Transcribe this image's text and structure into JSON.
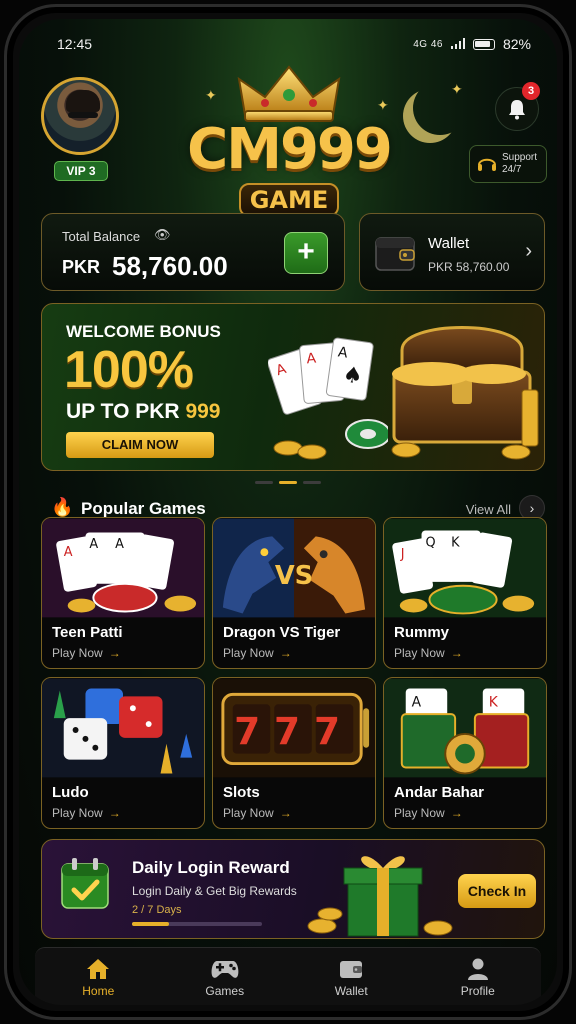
{
  "status_bar": {
    "time": "12:45",
    "network": "4G 46",
    "battery": "82%"
  },
  "header": {
    "vip_label": "VIP 3",
    "logo_title": "CM999",
    "logo_subtitle": "GAME",
    "notification_count": "3",
    "support_line1": "Support",
    "support_line2": "24/7"
  },
  "balance": {
    "label": "Total Balance",
    "currency": "PKR",
    "amount": "58,760.00",
    "add_label": "+"
  },
  "wallet": {
    "title": "Wallet",
    "amount": "PKR 58,760.00"
  },
  "banner": {
    "line1": "WELCOME BONUS",
    "line2": "100%",
    "line3_prefix": "UP TO PKR",
    "line3_value": "999",
    "cta": "CLAIM NOW",
    "page_index": 1,
    "page_count": 3
  },
  "popular": {
    "title": "Popular Games",
    "view_all": "View All",
    "games": [
      {
        "name": "Teen Patti",
        "cta": "Play Now"
      },
      {
        "name": "Dragon VS Tiger",
        "cta": "Play Now"
      },
      {
        "name": "Rummy",
        "cta": "Play Now"
      },
      {
        "name": "Ludo",
        "cta": "Play Now"
      },
      {
        "name": "Slots",
        "cta": "Play Now"
      },
      {
        "name": "Andar Bahar",
        "cta": "Play Now"
      }
    ],
    "dragon_vs_text": "VS",
    "slots_digits": "777"
  },
  "daily": {
    "title": "Daily Login Reward",
    "subtitle": "Login Daily & Get Big Rewards",
    "days": "2 / 7 Days",
    "progress": 0.2857,
    "cta": "Check In"
  },
  "nav": {
    "items": [
      {
        "label": "Home",
        "icon": "home-icon",
        "active": true
      },
      {
        "label": "Games",
        "icon": "gamepad-icon",
        "active": false
      },
      {
        "label": "Wallet",
        "icon": "wallet-icon",
        "active": false
      },
      {
        "label": "Profile",
        "icon": "profile-icon",
        "active": false
      }
    ]
  },
  "colors": {
    "accent_gold": "#e6b02a",
    "green": "#2a8a22",
    "badge_red": "#e2262b"
  }
}
